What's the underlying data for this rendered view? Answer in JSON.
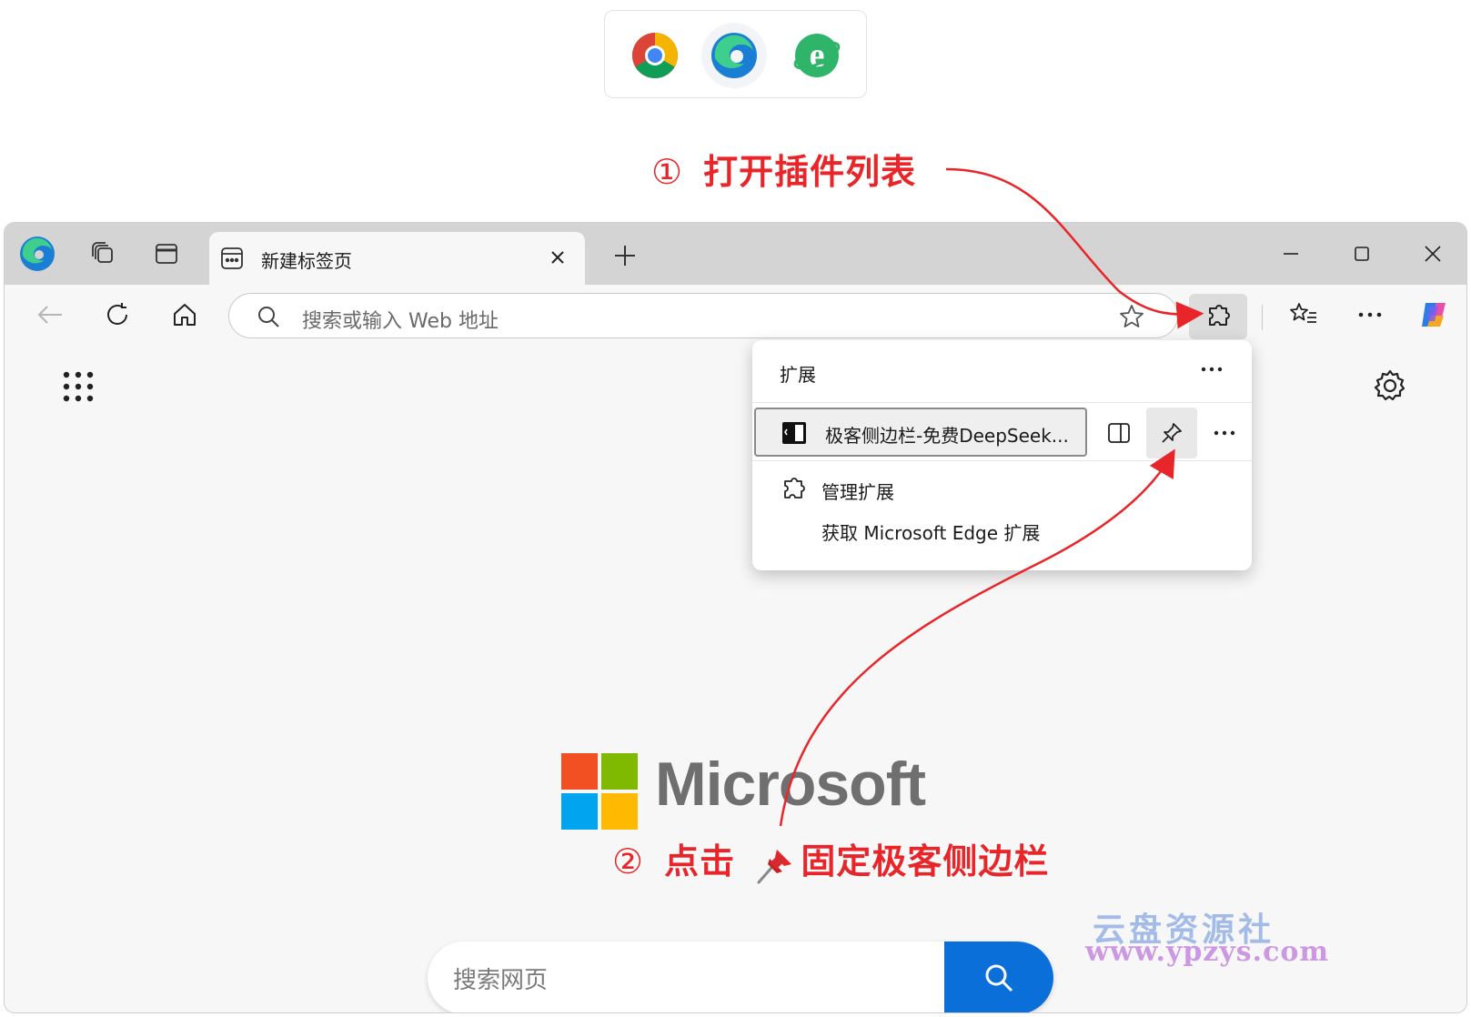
{
  "browser_picker": {
    "icons": [
      "chrome-icon",
      "edge-icon",
      "ie-icon"
    ]
  },
  "annotations": {
    "step1_number": "①",
    "step1_text": "打开插件列表",
    "step2_number": "②",
    "step2_text_before": "点击",
    "step2_pin_icon": "pushpin-emoji",
    "step2_text_after": "固定极客侧边栏",
    "color": "#e8262a"
  },
  "browser": {
    "tab": {
      "title": "新建标签页"
    },
    "address_bar": {
      "placeholder": "搜索或输入 Web 地址"
    },
    "new_tab_page": {
      "logo_text": "Microsoft",
      "search_placeholder": "搜索网页"
    },
    "accent_color": "#0a6fd8"
  },
  "extensions_popup": {
    "header": "扩展",
    "extension_name": "极客侧边栏-免费DeepSeek...",
    "manage": "管理扩展",
    "get_more": "获取 Microsoft Edge 扩展"
  },
  "watermark": {
    "line1": "云盘资源社",
    "line2": "www.ypzys.com"
  }
}
